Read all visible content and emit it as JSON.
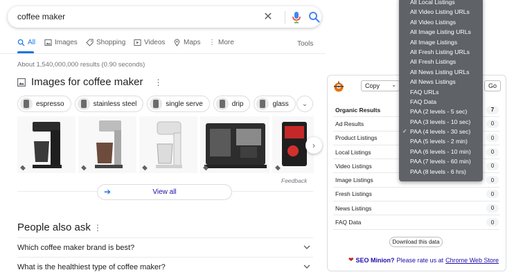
{
  "search": {
    "query": "coffee maker"
  },
  "tabs": [
    {
      "label": "All",
      "icon": "search-icon"
    },
    {
      "label": "Images",
      "icon": "image-icon"
    },
    {
      "label": "Shopping",
      "icon": "tag-icon"
    },
    {
      "label": "Videos",
      "icon": "play-icon"
    },
    {
      "label": "Maps",
      "icon": "pin-icon"
    },
    {
      "label": "More",
      "icon": "vertical-dots-icon"
    }
  ],
  "tools_label": "Tools",
  "stats": "About 1,540,000,000 results (0.90 seconds)",
  "images_section": {
    "title": "Images for coffee maker",
    "chips": [
      "espresso",
      "stainless steel",
      "single serve",
      "drip",
      "glass"
    ],
    "view_all": "View all",
    "feedback": "Feedback"
  },
  "paa": {
    "title": "People also ask",
    "questions": [
      "Which coffee maker brand is best?",
      "What is the healthiest type of coffee maker?"
    ]
  },
  "seo_panel": {
    "copy_select": "Copy",
    "go_label": "Go",
    "rows": [
      {
        "label": "Organic Results",
        "count": "7",
        "bold": true
      },
      {
        "label": "Ad Results",
        "count": "0"
      },
      {
        "label": "Product Listings",
        "count": "0"
      },
      {
        "label": "Local Listings",
        "count": "0"
      },
      {
        "label": "Video Listings",
        "count": "0"
      },
      {
        "label": "Image Listings",
        "count": "0"
      },
      {
        "label": "Fresh Listings",
        "count": "0"
      },
      {
        "label": "News Listings",
        "count": "0"
      },
      {
        "label": "FAQ Data",
        "count": "0"
      }
    ],
    "download_label": "Download this data",
    "rate_brand": "SEO Minion?",
    "rate_text": "Please rate us at",
    "rate_link": "Chrome Web Store",
    "accent_color": "#e8710a"
  },
  "dropdown": {
    "selected_index": 13,
    "items": [
      "All Local Listings",
      "All Video Listing URLs",
      "All Video Listings",
      "All Image Listing URLs",
      "All Image Listings",
      "All Fresh Listing URLs",
      "All Fresh Listings",
      "All News Listing URLs",
      "All News Listings",
      "FAQ URLs",
      "FAQ Data",
      "PAA (2 levels - 5 sec)",
      "PAA (3 levels - 10 sec)",
      "PAA (4 levels - 30 sec)",
      "PAA (5 levels - 2 min)",
      "PAA (6 levels - 10 min)",
      "PAA (7 levels - 60 min)",
      "PAA (8 levels - 6 hrs)"
    ]
  }
}
